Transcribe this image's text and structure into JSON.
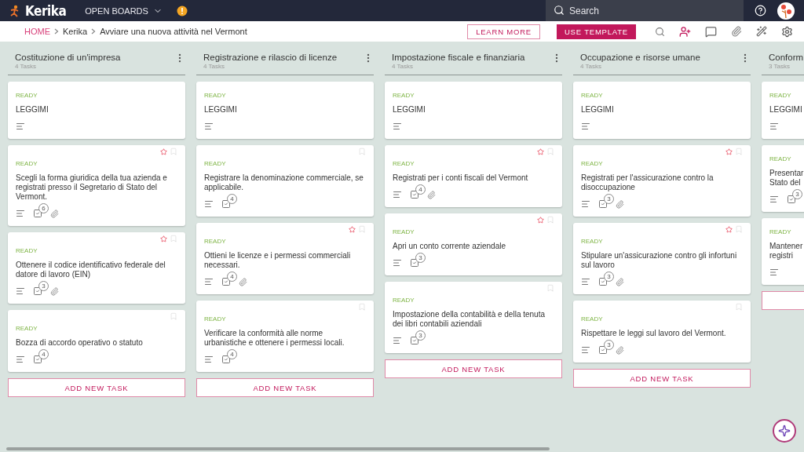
{
  "topbar": {
    "brand": "Kerika",
    "boards_menu": "OPEN BOARDS",
    "search": {
      "placeholder": "Search"
    }
  },
  "breadcrumb": {
    "items": [
      "HOME",
      "Kerika",
      "Avviare una nuova attività nel Vermont"
    ]
  },
  "actions": {
    "learn_more": "LEARN MORE",
    "use_template": "USE TEMPLATE"
  },
  "columns": [
    {
      "title": "Costituzione di un'impresa",
      "count": "4 Tasks",
      "add_label": "ADD NEW TASK",
      "cards": [
        {
          "status": "READY",
          "title": "LEGGIMI",
          "flags": false,
          "starred": false,
          "attachment": false
        },
        {
          "status": "READY",
          "title": "Scegli la forma giuridica della tua azienda e registrati presso il Segretario di Stato del Vermont.",
          "flags": true,
          "starred": true,
          "checklist": "6",
          "attachment": true
        },
        {
          "status": "READY",
          "title": "Ottenere il codice identificativo federale del datore di lavoro (EIN)",
          "flags": true,
          "starred": true,
          "checklist": "3",
          "attachment": true
        },
        {
          "status": "READY",
          "title": "Bozza di accordo operativo o statuto",
          "flags": true,
          "starred": false,
          "checklist": "4",
          "attachment": false
        }
      ]
    },
    {
      "title": "Registrazione e rilascio di licenze",
      "count": "4 Tasks",
      "add_label": "ADD NEW TASK",
      "cards": [
        {
          "status": "READY",
          "title": "LEGGIMI",
          "flags": false,
          "starred": false,
          "attachment": false
        },
        {
          "status": "READY",
          "title": "Registrare la denominazione commerciale, se applicabile.",
          "flags": true,
          "starred": false,
          "checklist": "4",
          "attachment": false
        },
        {
          "status": "READY",
          "title": "Ottieni le licenze e i permessi commerciali necessari.",
          "flags": true,
          "starred": true,
          "checklist": "4",
          "attachment": true
        },
        {
          "status": "READY",
          "title": "Verificare la conformità alle norme urbanistiche e ottenere i permessi locali.",
          "flags": true,
          "starred": false,
          "checklist": "4",
          "attachment": false
        }
      ]
    },
    {
      "title": "Impostazione fiscale e finanziaria",
      "count": "4 Tasks",
      "add_label": "ADD NEW TASK",
      "cards": [
        {
          "status": "READY",
          "title": "LEGGIMI",
          "flags": false,
          "starred": false,
          "attachment": false
        },
        {
          "status": "READY",
          "title": "Registrati per i conti fiscali del Vermont",
          "flags": true,
          "starred": true,
          "checklist": "4",
          "attachment": true
        },
        {
          "status": "READY",
          "title": "Apri un conto corrente aziendale",
          "flags": true,
          "starred": true,
          "checklist": "3",
          "attachment": false
        },
        {
          "status": "READY",
          "title": "Impostazione della contabilità e della tenuta dei libri contabili aziendali",
          "flags": true,
          "starred": false,
          "checklist": "3",
          "attachment": false
        }
      ]
    },
    {
      "title": "Occupazione e risorse umane",
      "count": "4 Tasks",
      "add_label": "ADD NEW TASK",
      "cards": [
        {
          "status": "READY",
          "title": "LEGGIMI",
          "flags": false,
          "starred": false,
          "attachment": false
        },
        {
          "status": "READY",
          "title": "Registrati per l'assicurazione contro la disoccupazione",
          "flags": true,
          "starred": true,
          "checklist": "3",
          "attachment": true
        },
        {
          "status": "READY",
          "title": "Stipulare un'assicurazione contro gli infortuni sul lavoro",
          "flags": true,
          "starred": true,
          "checklist": "3",
          "attachment": true
        },
        {
          "status": "READY",
          "title": "Rispettare le leggi sul lavoro del Vermont.",
          "flags": true,
          "starred": false,
          "checklist": "3",
          "attachment": true
        }
      ]
    },
    {
      "title": "Conform",
      "count": "3 Tasks",
      "cut": true,
      "cards": [
        {
          "status": "READY",
          "title": "LEGGIMI",
          "flags": false,
          "starred": false,
          "attachment": false
        },
        {
          "status": "READY",
          "title": "Presentar Stato del",
          "flags": false,
          "starred": false,
          "checklist": "3",
          "attachment": false
        },
        {
          "status": "READY",
          "title": "Mantener registri",
          "flags": false,
          "starred": false,
          "attachment": false
        }
      ]
    }
  ]
}
